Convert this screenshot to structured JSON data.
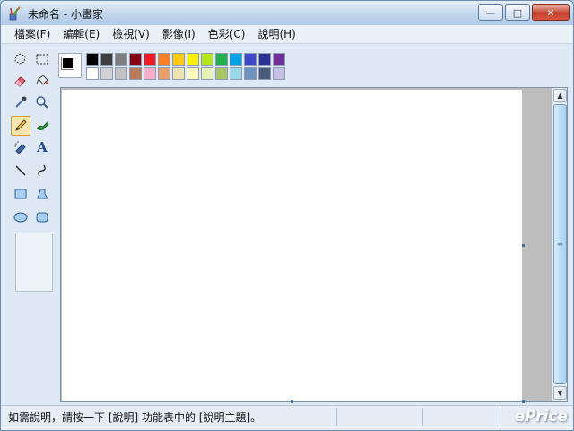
{
  "window": {
    "title": "未命名 - 小畫家",
    "buttons": {
      "minimize": "—",
      "maximize": "□",
      "close": "✕"
    }
  },
  "menu": [
    "檔案(F)",
    "編輯(E)",
    "檢視(V)",
    "影像(I)",
    "色彩(C)",
    "說明(H)"
  ],
  "tools": [
    {
      "name": "free-form-select-tool",
      "icon": "free-select-icon"
    },
    {
      "name": "select-tool",
      "icon": "rect-select-icon"
    },
    {
      "name": "eraser-tool",
      "icon": "eraser-icon"
    },
    {
      "name": "fill-tool",
      "icon": "paint-bucket-icon"
    },
    {
      "name": "color-picker-tool",
      "icon": "eyedropper-icon"
    },
    {
      "name": "magnifier-tool",
      "icon": "magnifier-icon"
    },
    {
      "name": "pencil-tool",
      "icon": "pencil-icon",
      "selected": true
    },
    {
      "name": "brush-tool",
      "icon": "brush-icon"
    },
    {
      "name": "airbrush-tool",
      "icon": "airbrush-icon"
    },
    {
      "name": "text-tool",
      "icon": "text-icon",
      "glyph": "A"
    },
    {
      "name": "line-tool",
      "icon": "line-icon"
    },
    {
      "name": "curve-tool",
      "icon": "curve-icon"
    },
    {
      "name": "rectangle-tool",
      "icon": "rectangle-icon"
    },
    {
      "name": "polygon-tool",
      "icon": "polygon-icon"
    },
    {
      "name": "ellipse-tool",
      "icon": "ellipse-icon"
    },
    {
      "name": "rounded-rectangle-tool",
      "icon": "rounded-rect-icon"
    }
  ],
  "palette": {
    "foreground": "#000000",
    "background": "#ffffff",
    "row1": [
      "#000000",
      "#3f3f3f",
      "#7f7f7f",
      "#880015",
      "#ed1c24",
      "#ff7f27",
      "#ffc90e",
      "#fff200",
      "#b5e61d",
      "#22b14c",
      "#00a2e8",
      "#3f48cc",
      "#2b3296",
      "#6f3198"
    ],
    "row2": [
      "#ffffff",
      "#d2d2d2",
      "#c3c3c3",
      "#b97a57",
      "#ffaec9",
      "#e8a06a",
      "#efe4b0",
      "#fff9bd",
      "#e6f5b5",
      "#a8c464",
      "#99d9ea",
      "#7092be",
      "#4a5a7c",
      "#c8bfe7"
    ]
  },
  "status": {
    "help_text": "如需說明，請按一下 [說明] 功能表中的 [說明主題]。",
    "watermark": "ePrice"
  }
}
